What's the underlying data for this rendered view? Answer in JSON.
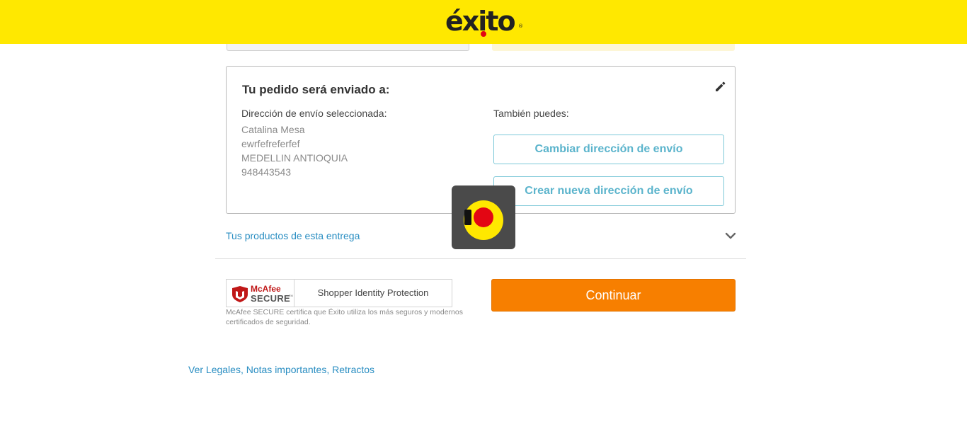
{
  "header": {
    "logo_text": "éxito",
    "logo_reg": "®",
    "bg_color": "#ffe800"
  },
  "shipping": {
    "title": "Tu pedido será enviado a:",
    "edit_icon": "pencil-icon",
    "selected_label": "Dirección de envío seleccionada:",
    "address_lines": [
      "Catalina Mesa",
      "ewrfefreferfef",
      "MEDELLIN ANTIOQUIA",
      "948443543"
    ],
    "also_label": "También puedes:",
    "change_button": "Cambiar dirección de envío",
    "new_button": "Crear nueva dirección de envío",
    "accent_color": "#5bb4cc"
  },
  "products": {
    "link_text": "Tus productos de esta entrega",
    "chevron_icon": "chevron-down-icon"
  },
  "loader": {
    "icon": "exito-loading-icon"
  },
  "security": {
    "brand_name": "McAfee",
    "brand_secure": "SECURE",
    "brand_tm": "TM",
    "protection_text": "Shopper Identity Protection",
    "note": "McAfee SECURE certifica que Éxito utiliza los más seguros y modernos certificados de seguridad."
  },
  "checkout": {
    "continue_label": "Continuar",
    "button_color": "#f77f00"
  },
  "footer": {
    "legal_link": "Ver Legales",
    "notes_link": "Notas importantes",
    "retract_link": "Retractos",
    "separator": ", "
  }
}
